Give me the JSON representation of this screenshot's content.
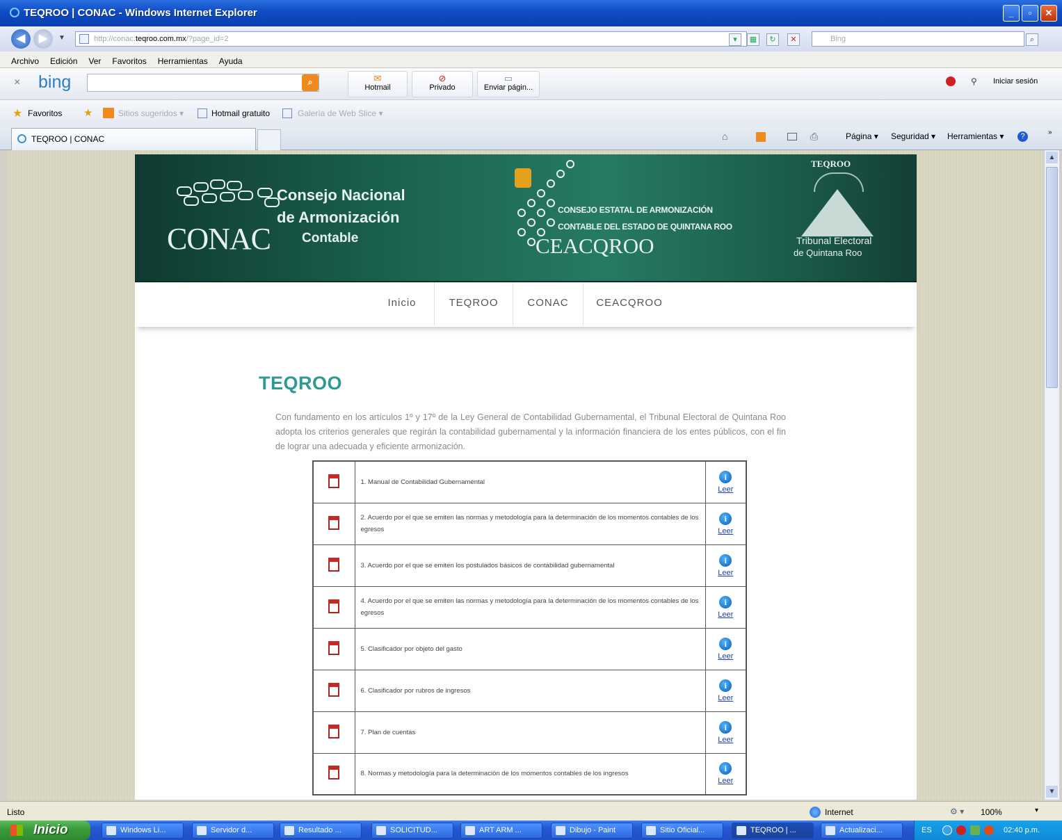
{
  "window": {
    "title": "TEQROO | CONAC - Windows Internet Explorer"
  },
  "address_bar": {
    "url_prefix": "http://conac.",
    "url_domain": "teqroo.com.mx",
    "url_path": "/?page_id=2",
    "search_placeholder": "Bing"
  },
  "menu": [
    "Archivo",
    "Edición",
    "Ver",
    "Favoritos",
    "Herramientas",
    "Ayuda"
  ],
  "bing_bar": {
    "logo": "bing",
    "buttons": [
      "Hotmail",
      "Privado",
      "Enviar págin..."
    ],
    "signin": "Iniciar sesión"
  },
  "favorites_bar": {
    "favorites": "Favoritos",
    "items": [
      "Sitios sugeridos ▾",
      "Hotmail gratuito",
      "Galería de Web Slice ▾"
    ]
  },
  "tab": {
    "label": "TEQROO | CONAC"
  },
  "command_bar": [
    "Página ▾",
    "Seguridad ▾",
    "Herramientas ▾"
  ],
  "site": {
    "banner": {
      "conac_big": "CONAC",
      "conac_lines": [
        "Consejo Nacional",
        "de Armonización",
        "Contable"
      ],
      "ceac_lines": [
        "CONSEJO ESTATAL DE ARMONIZACIÓN",
        "CONTABLE DEL ESTADO DE QUINTANA ROO"
      ],
      "ceac_name": "CEACQROO",
      "teq_top": "TEQROO",
      "teq_name_1": "Tribunal Electoral",
      "teq_name_2": "de Quintana Roo"
    },
    "nav": [
      "Inicio",
      "TEQROO",
      "CONAC",
      "CEACQROO"
    ],
    "page_title": "TEQROO",
    "intro": "Con fundamento en los artículos 1º y 17º de la Ley General de Contabilidad Gubernamental, el Tribunal Electoral de Quintana Roo adopta los criterios generales que regirán la contabilidad gubernamental y la información financiera de los entes públicos, con el fin de lograr una adecuada y eficiente armonización.",
    "documents": [
      {
        "text": "1. Manual de Contabilidad Gubernamental",
        "link": "Leer"
      },
      {
        "text": "2. Acuerdo por el que se emiten las normas y metodología para la determinación de los momentos contables de los egresos",
        "link": "Leer"
      },
      {
        "text": "3. Acuerdo por el que se emiten los postulados básicos de contabilidad gubernamental",
        "link": "Leer"
      },
      {
        "text": "4. Acuerdo por el que se emiten las normas y metodología para la determinación de los momentos contables de los egresos",
        "link": "Leer"
      },
      {
        "text": "5. Clasificador por objeto del gasto",
        "link": "Leer"
      },
      {
        "text": "6. Clasificador por rubros de ingresos",
        "link": "Leer"
      },
      {
        "text": "7. Plan de cuentas",
        "link": "Leer"
      },
      {
        "text": "8. Normas y metodología para la determinación de los momentos contables de los ingresos",
        "link": "Leer"
      }
    ]
  },
  "status_bar": {
    "left": "Listo",
    "zone": "Internet",
    "zoom": "100%"
  },
  "taskbar": {
    "start": "Inicio",
    "buttons": [
      "Windows Li...",
      "Servidor d...",
      "Resultado ...",
      "SOLICITUD...",
      "ART ARM ...",
      "Dibujo - Paint",
      "Sitio Oficial...",
      "TEQROO | ...",
      "Actualizaci..."
    ],
    "lang": "ES",
    "clock": "02:40 p.m."
  }
}
